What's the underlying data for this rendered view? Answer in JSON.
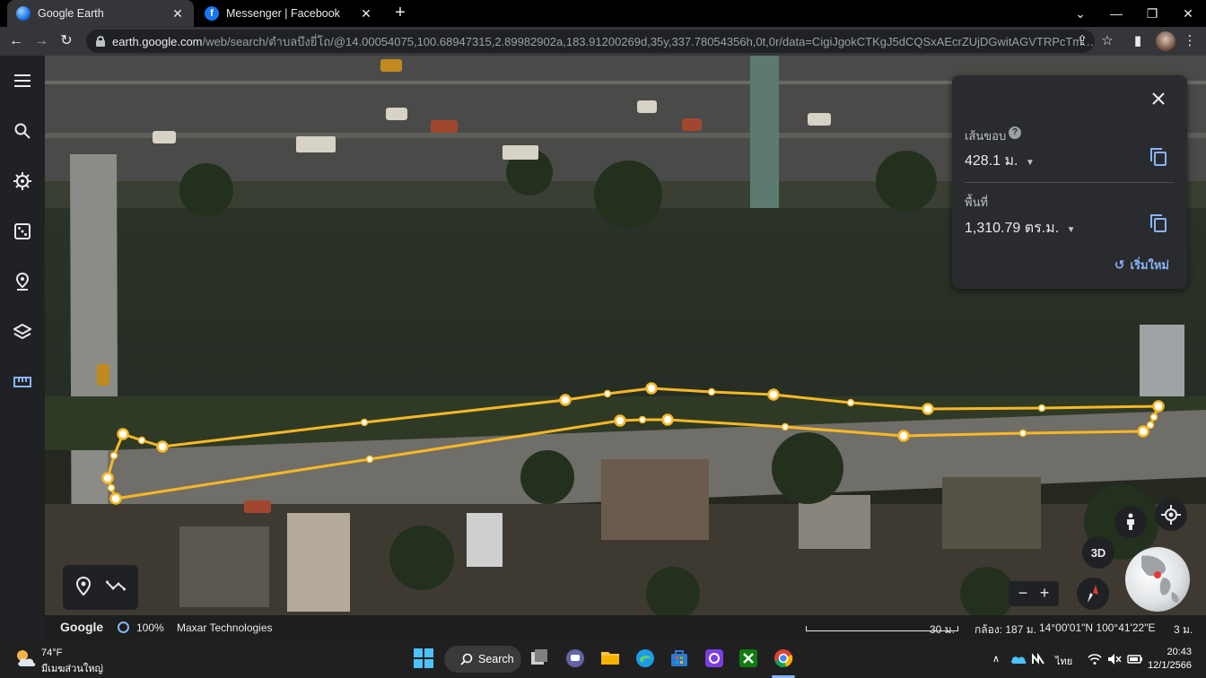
{
  "browser": {
    "tabs": [
      {
        "title": "Google Earth",
        "active": true
      },
      {
        "title": "Messenger | Facebook",
        "active": false
      }
    ],
    "new_tab_label": "+",
    "url_host": "earth.google.com",
    "url_rest": "/web/search/ตำบลบึงยี่โถ/@14.00054075,100.68947315,2.89982902a,183.91200269d,35y,337.78054356h,0t,0r/data=CigiJgokCTKgJ5dCQSxAEcrZUjDGwitAGVTRPcTmO1lAIZ-zTuLvH..."
  },
  "earth": {
    "measure": {
      "perimeter_label": "เส้นขอบ",
      "perimeter_value": "428.1 ม.",
      "area_label": "พื้นที่",
      "area_value": "1,310.79 ตร.ม.",
      "reset_label": "เริ่มใหม่"
    },
    "view_3d_label": "3D",
    "attribution": {
      "brand": "Google",
      "opacity": "100%",
      "provider": "Maxar Technologies",
      "scale": "30 ม.",
      "camera": "กล้อง: 187 ม.",
      "coords": "14°00'01\"N 100°41'22\"E",
      "elevation": "3 ม."
    }
  },
  "taskbar": {
    "weather_temp": "74°F",
    "weather_desc": "มีเมฆส่วนใหญ่",
    "search_label": "Search",
    "lang": "ไทย",
    "time": "20:43",
    "date": "12/1/2566"
  },
  "colors": {
    "measure_line": "#f7b826",
    "accent_blue": "#8ab4f8"
  }
}
